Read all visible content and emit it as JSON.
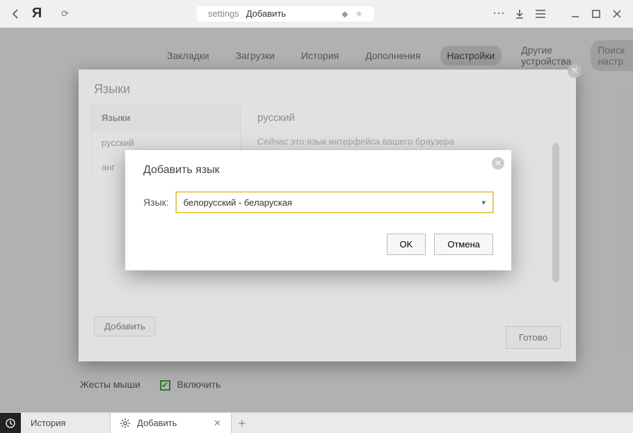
{
  "toolbar": {
    "address_grey": "settings",
    "address_text": "Добавить"
  },
  "nav": {
    "items": [
      "Закладки",
      "Загрузки",
      "История",
      "Дополнения",
      "Настройки",
      "Другие устройства"
    ],
    "active_index": 4,
    "search_placeholder": "Поиск настр"
  },
  "lang_panel": {
    "title": "Языки",
    "left_header": "Языки",
    "languages": [
      "русский",
      "анг"
    ],
    "current_language": "русский",
    "description": "Сейчас это язык интерфейса вашего браузера",
    "add_button": "Добавить",
    "done_button": "Готово"
  },
  "add_dialog": {
    "title": "Добавить язык",
    "label": "Язык:",
    "selected": "белорусский - беларуская",
    "ok": "OK",
    "cancel": "Отмена"
  },
  "gestures": {
    "label": "Жесты мыши",
    "checkbox_label": "Включить"
  },
  "tabbar": {
    "tabs": [
      {
        "label": "История"
      },
      {
        "label": "Добавить"
      }
    ]
  }
}
